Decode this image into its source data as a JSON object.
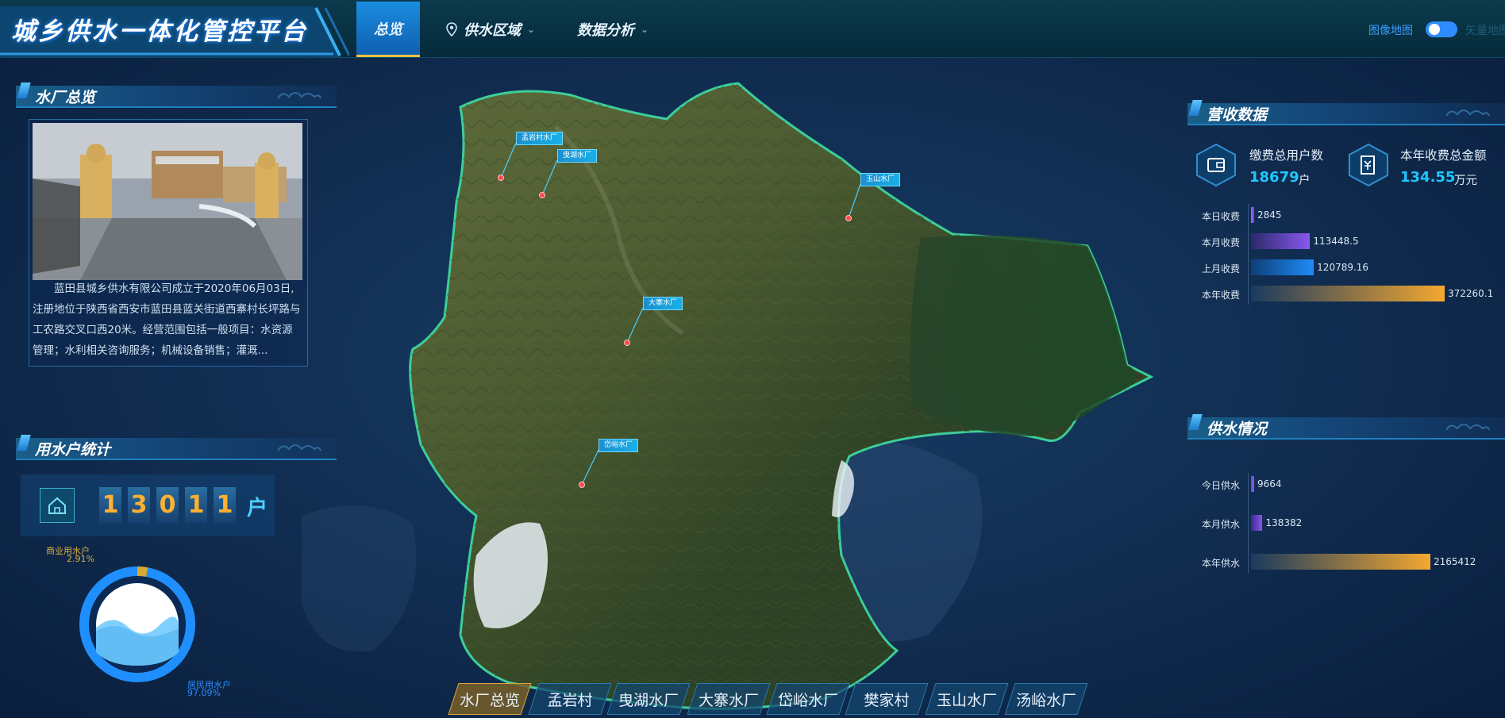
{
  "header": {
    "title": "城乡供水一体化管控平台",
    "nav": [
      {
        "label": "总览",
        "active": true
      },
      {
        "label": "供水区域",
        "icon": "location-pin-icon",
        "has_dropdown": true
      },
      {
        "label": "数据分析",
        "has_dropdown": true
      }
    ],
    "map_toggle_label": "图像地图",
    "map_toggle_on": true,
    "map_toggle_alt_label": "矢量地图"
  },
  "plant_overview": {
    "title": "水厂总览",
    "description": "蓝田县城乡供水有限公司成立于2020年06月03日,注册地位于陕西省西安市蓝田县蓝关街道西寨村长坪路与工农路交叉口西20米。经营范围包括一般项目：水资源管理；水利相关咨询服务；机械设备销售；灌溉..."
  },
  "water_users": {
    "title": "用水户统计",
    "digits": [
      "1",
      "3",
      "0",
      "1",
      "1"
    ],
    "unit": "户",
    "commercial": {
      "label": "商业用水户",
      "percent": "2.91%",
      "value": 2.91,
      "color": "#d8a830"
    },
    "residential": {
      "label": "居民用水户",
      "percent": "97.09%",
      "value": 97.09,
      "color": "#1f8fff"
    }
  },
  "revenue": {
    "title": "营收数据",
    "total_users_label": "缴费总用户数",
    "total_users_value": "18679",
    "total_users_unit": "户",
    "annual_amount_label": "本年收费总金额",
    "annual_amount_value": "134.55",
    "annual_amount_unit": "万元",
    "bars": [
      {
        "label": "本日收费",
        "value": 2845,
        "display": "2845",
        "color_from": "#9a6cff",
        "color_to": "#6a3ad8"
      },
      {
        "label": "本月收费",
        "value": 113448.5,
        "display": "113448.5",
        "color_from": "#2a2a6a",
        "color_to": "#8a58f0"
      },
      {
        "label": "上月收费",
        "value": 120789.16,
        "display": "120789.16",
        "color_from": "#0e3f7a",
        "color_to": "#1e8cf8"
      },
      {
        "label": "本年收费",
        "value": 372260.1,
        "display": "372260.1",
        "color_from": "#1a3a5e",
        "color_to": "#f4a830"
      }
    ]
  },
  "supply": {
    "title": "供水情况",
    "bars": [
      {
        "label": "今日供水",
        "value": 9664,
        "display": "9664",
        "color_from": "#6a4ad8",
        "color_to": "#8a58f0"
      },
      {
        "label": "本月供水",
        "value": 138382,
        "display": "138382",
        "color_from": "#3a2a8a",
        "color_to": "#8a58f0"
      },
      {
        "label": "本年供水",
        "value": 2165412,
        "display": "2165412",
        "color_from": "#1a3a5e",
        "color_to": "#f4a830"
      }
    ]
  },
  "map": {
    "plants": [
      {
        "label": "孟岩村水厂"
      },
      {
        "label": "曳湖水厂"
      },
      {
        "label": "玉山水厂"
      },
      {
        "label": "大寨水厂"
      },
      {
        "label": "岱峪水厂"
      }
    ]
  },
  "bottom_tabs": [
    {
      "label": "水厂总览",
      "active": true
    },
    {
      "label": "孟岩村"
    },
    {
      "label": "曳湖水厂"
    },
    {
      "label": "大寨水厂"
    },
    {
      "label": "岱峪水厂"
    },
    {
      "label": "樊家村"
    },
    {
      "label": "玉山水厂"
    },
    {
      "label": "汤峪水厂"
    }
  ]
}
